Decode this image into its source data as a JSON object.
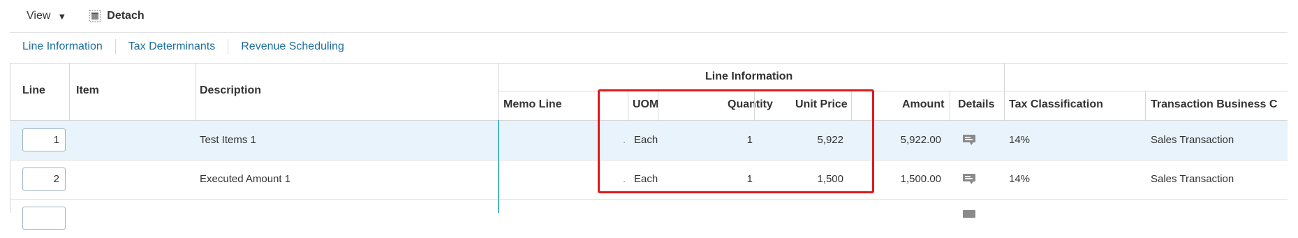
{
  "toolbar": {
    "view_label": "View",
    "view_caret": "▼",
    "detach_label": "Detach"
  },
  "subtabs": [
    "Line Information",
    "Tax Determinants",
    "Revenue Scheduling"
  ],
  "table": {
    "group_header": "Line Information",
    "headers": {
      "line": "Line",
      "item": "Item",
      "description": "Description",
      "memo_line": "Memo Line",
      "uom": "UOM",
      "quantity": "Quantity",
      "unit_price": "Unit Price",
      "amount": "Amount",
      "details": "Details",
      "tax_classification": "Tax Classification",
      "transaction_business": "Transaction Business C"
    },
    "rows": [
      {
        "line": "1",
        "item": "",
        "description": "Test Items 1",
        "memo_line": "",
        "dot": ".",
        "uom": "Each",
        "quantity": "1",
        "unit_price": "5,922",
        "amount": "5,922.00",
        "tax_classification": "14%",
        "transaction_business": "Sales Transaction",
        "selected": true
      },
      {
        "line": "2",
        "item": "",
        "description": "Executed Amount 1",
        "memo_line": "",
        "dot": ".",
        "uom": "Each",
        "quantity": "1",
        "unit_price": "1,500",
        "amount": "1,500.00",
        "tax_classification": "14%",
        "transaction_business": "Sales Transaction",
        "selected": false
      },
      {
        "line": "",
        "item": "",
        "description": "",
        "memo_line": "",
        "dot": "",
        "uom": "",
        "quantity": "",
        "unit_price": "",
        "amount": "",
        "tax_classification": "",
        "transaction_business": "",
        "selected": false
      }
    ]
  },
  "colors": {
    "link": "#1f6f9f",
    "selected_row": "#e8f3fb",
    "highlight_box": "#e0191c",
    "frozen_divider": "#4fb3c9"
  },
  "icons": {
    "view_menu": "chevron-down-icon",
    "detach": "detach-icon",
    "details": "details-icon"
  }
}
